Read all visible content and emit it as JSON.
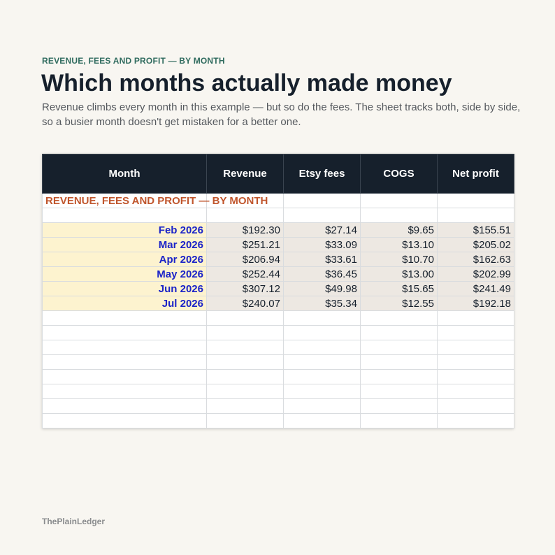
{
  "header": {
    "eyebrow": "REVENUE, FEES AND PROFIT — BY MONTH",
    "title": "Which months actually made money",
    "subtitle": "Revenue climbs every month in this example — but so do the fees. The sheet tracks both, side by side, so a busier month doesn't get mistaken for a better one."
  },
  "sheet": {
    "title": "REVENUE, FEES AND PROFIT — BY MONTH",
    "columns": [
      "Month",
      "Revenue",
      "Etsy fees",
      "COGS",
      "Net profit"
    ],
    "rows": [
      [
        "Feb 2026",
        "$192.30",
        "$27.14",
        "$9.65",
        "$155.51"
      ],
      [
        "Mar 2026",
        "$251.21",
        "$33.09",
        "$13.10",
        "$205.02"
      ],
      [
        "Apr 2026",
        "$206.94",
        "$33.61",
        "$10.70",
        "$162.63"
      ],
      [
        "May 2026",
        "$252.44",
        "$36.45",
        "$13.00",
        "$202.99"
      ],
      [
        "Jun 2026",
        "$307.12",
        "$49.98",
        "$15.65",
        "$241.49"
      ],
      [
        "Jul 2026",
        "$240.07",
        "$35.34",
        "$12.55",
        "$192.18"
      ]
    ]
  },
  "footer": {
    "brand": "ThePlainLedger"
  },
  "colors": {
    "background": "#f8f6f1",
    "header_bg": "#16202c",
    "month_fill": "#fdf3cf",
    "value_fill": "#ede8e2",
    "month_text": "#1b23c8",
    "sheet_title": "#c0562d",
    "eyebrow": "#2f6b5e"
  }
}
